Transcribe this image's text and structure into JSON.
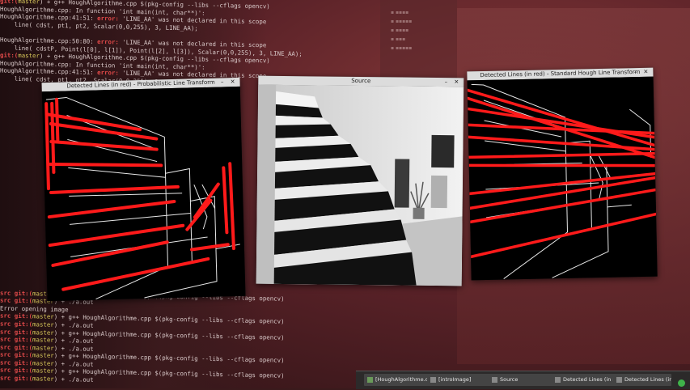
{
  "terminal": {
    "lines": [
      {
        "pre": "git:(",
        "br": "master",
        "post": ") + g++ HoughAlgorithme.cpp $(pkg-config --libs --cflags opencv)"
      },
      {
        "pre": "",
        "br": "",
        "post": "HoughAlgorithme.cpp: In function 'int main(int, char**)':"
      },
      {
        "pre": "",
        "br": "",
        "post": "HoughAlgorithme.cpp:41:51: ",
        "err": "error: ",
        "post2": "'LINE_AA' was not declared in this scope"
      },
      {
        "pre": "",
        "br": "",
        "post": "    line( cdst, pt1, pt2, Scalar(0,0,255), 3, LINE_AA);"
      },
      {
        "pre": "",
        "br": "",
        "post": ""
      },
      {
        "pre": "",
        "br": "",
        "post": "HoughAlgorithme.cpp:50:80: ",
        "err": "error: ",
        "post2": "'LINE_AA' was not declared in this scope"
      },
      {
        "pre": "",
        "br": "",
        "post": "    line( cdstP, Point(l[0], l[1]), Point(l[2], l[3]), Scalar(0,0,255), 3, LINE_AA);"
      },
      {
        "pre": "git:(",
        "br": "master",
        "post": ") + g++ HoughAlgorithme.cpp $(pkg-config --libs --cflags opencv)"
      },
      {
        "pre": "",
        "br": "",
        "post": "HoughAlgorithme.cpp: In function 'int main(int, char**)':"
      },
      {
        "pre": "",
        "br": "",
        "post": "HoughAlgorithme.cpp:41:51: ",
        "err": "error: ",
        "post2": "'LINE_AA' was not declared in this scope"
      },
      {
        "pre": "",
        "br": "",
        "post": "    line( cdst, pt1, pt2, Scalar(0,0,255), 3, LINE_AA);"
      }
    ],
    "lower_lines": [
      {
        "pre": "src git:(",
        "br": "master",
        "post": ") + g++ HoughAlgorithme.cpp $(pkg-config --libs --cflags opencv)"
      },
      {
        "pre": "src git:(",
        "br": "master",
        "post": ") + ./a.out"
      },
      {
        "pre": "",
        "br": "",
        "post": "Error opening image"
      },
      {
        "pre": "src git:(",
        "br": "master",
        "post": ") + g++ HoughAlgorithme.cpp $(pkg-config --libs --cflags opencv)"
      },
      {
        "pre": "src git:(",
        "br": "master",
        "post": ") + ./a.out"
      },
      {
        "pre": "src git:(",
        "br": "master",
        "post": ") + g++ HoughAlgorithme.cpp $(pkg-config --libs --cflags opencv)"
      },
      {
        "pre": "src git:(",
        "br": "master",
        "post": ") + ./a.out"
      },
      {
        "pre": "src git:(",
        "br": "master",
        "post": ") + ./a.out"
      },
      {
        "pre": "src git:(",
        "br": "master",
        "post": ") + g++ HoughAlgorithme.cpp $(pkg-config --libs --cflags opencv)"
      },
      {
        "pre": "src git:(",
        "br": "master",
        "post": ") + ./a.out"
      },
      {
        "pre": "src git:(",
        "br": "master",
        "post": ") + g++ HoughAlgorithme.cpp $(pkg-config --libs --cflags opencv)"
      },
      {
        "pre": "src git:(",
        "br": "master",
        "post": ") + ./a.out"
      }
    ]
  },
  "windows": {
    "probabilistic": {
      "title": "Detected Lines (in red) - Probabilistic Line Transform"
    },
    "source": {
      "title": "Source"
    },
    "standard": {
      "title": "Detected Lines (in red) - Standard Hough Line Transform"
    },
    "controls": "– ✕"
  },
  "taskbar": {
    "items": [
      "[HoughAlgorithme.c...",
      "[introImage]",
      "Source",
      "Detected Lines (in re...",
      "Detected Lines (in re..."
    ]
  },
  "colors": {
    "line_red": "#ff1a1a",
    "edge_white": "#e8e8e8",
    "accent": "#e14a4a"
  }
}
